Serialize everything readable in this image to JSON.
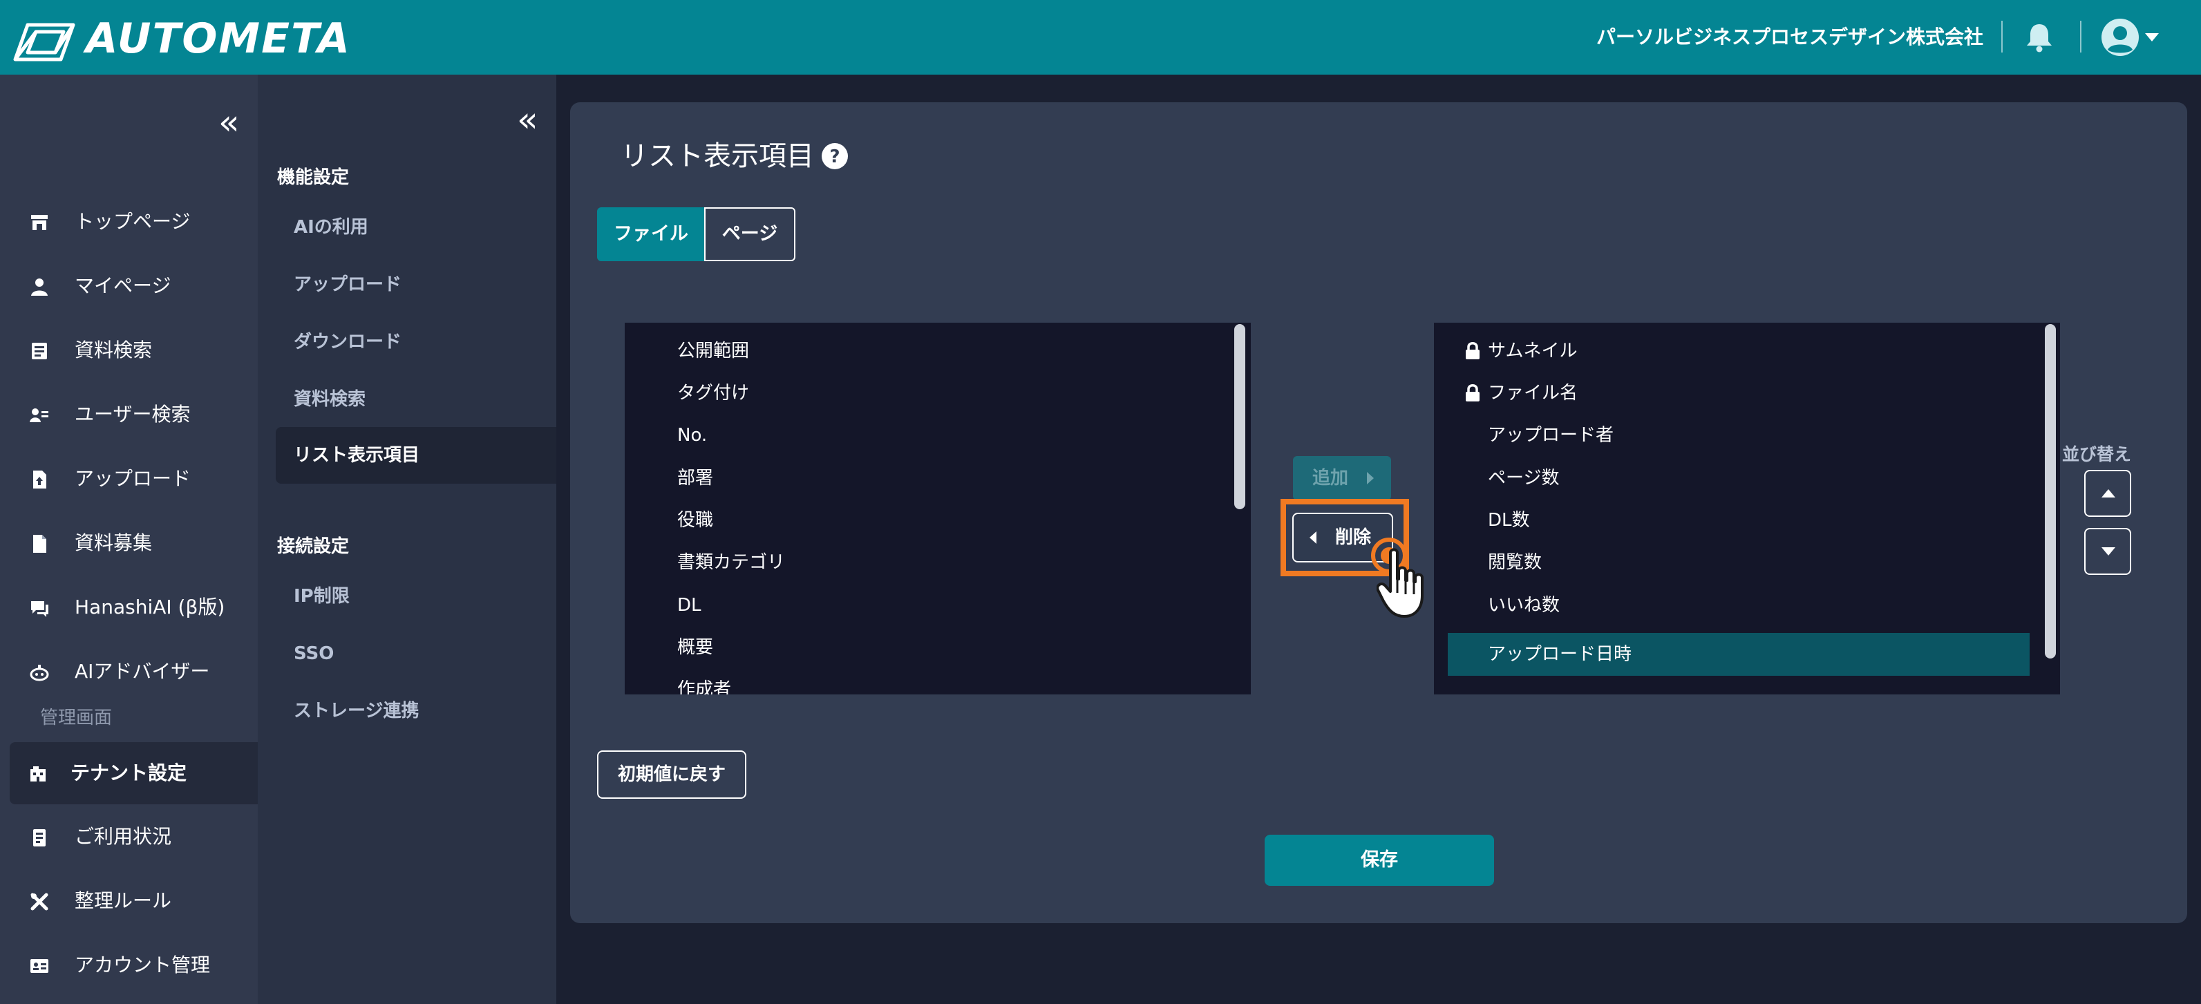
{
  "header": {
    "logo_text": "AUTOMETA",
    "company_name": "パーソルビジネスプロセスデザイン株式会社",
    "icons": [
      "logo-icon",
      "bell-icon",
      "user-avatar-icon",
      "caret-down-icon"
    ]
  },
  "sidebar": {
    "collapse_glyph": "«",
    "items": [
      {
        "label": "トップページ",
        "icon": "store-icon"
      },
      {
        "label": "マイページ",
        "icon": "user-icon"
      },
      {
        "label": "資料検索",
        "icon": "document-search-icon"
      },
      {
        "label": "ユーザー検索",
        "icon": "user-search-icon"
      },
      {
        "label": "アップロード",
        "icon": "upload-file-icon"
      },
      {
        "label": "資料募集",
        "icon": "file-icon"
      },
      {
        "label": "HanashiAI (β版)",
        "icon": "chat-icon"
      },
      {
        "label": "AIアドバイザー",
        "icon": "robot-icon"
      }
    ],
    "admin_section_label": "管理画面",
    "admin_items": [
      {
        "label": "テナント設定",
        "icon": "building-icon",
        "active": true
      },
      {
        "label": "ご利用状況",
        "icon": "report-icon"
      },
      {
        "label": "整理ルール",
        "icon": "tools-icon"
      },
      {
        "label": "アカウント管理",
        "icon": "id-card-icon"
      }
    ]
  },
  "subsidebar": {
    "collapse_glyph": "«",
    "feature_heading": "機能設定",
    "feature_items": [
      "AIの利用",
      "アップロード",
      "ダウンロード",
      "資料検索",
      "リスト表示項目"
    ],
    "active_item": "リスト表示項目",
    "connection_heading": "接続設定",
    "connection_items": [
      "IP制限",
      "SSO",
      "ストレージ連携"
    ]
  },
  "main": {
    "title": "リスト表示項目",
    "help_icon": "help-circle-icon",
    "tabs": {
      "file": "ファイル",
      "page": "ページ",
      "selected": "ファイル"
    },
    "available_items": [
      "公開範囲",
      "タグ付け",
      "No.",
      "部署",
      "役職",
      "書類カテゴリ",
      "DL",
      "概要",
      "作成者"
    ],
    "selected_items": [
      {
        "label": "サムネイル",
        "locked": true
      },
      {
        "label": "ファイル名",
        "locked": true
      },
      {
        "label": "アップロード者",
        "locked": false
      },
      {
        "label": "ページ数",
        "locked": false
      },
      {
        "label": "DL数",
        "locked": false
      },
      {
        "label": "閲覧数",
        "locked": false
      },
      {
        "label": "いいね数",
        "locked": false
      },
      {
        "label": "アップロード日時",
        "locked": false,
        "highlighted": true
      }
    ],
    "add_label": "追加",
    "remove_label": "削除",
    "sort_label": "並び替え",
    "reset_label": "初期値に戻す",
    "save_label": "保存"
  },
  "colors": {
    "header_bg": "#048593",
    "accent": "#048593",
    "highlight_orange": "#f07a22",
    "sidebar_bg": "#31394d",
    "card_bg": "#333d52",
    "list_bg": "#141629",
    "selected_row": "#0b5563"
  }
}
